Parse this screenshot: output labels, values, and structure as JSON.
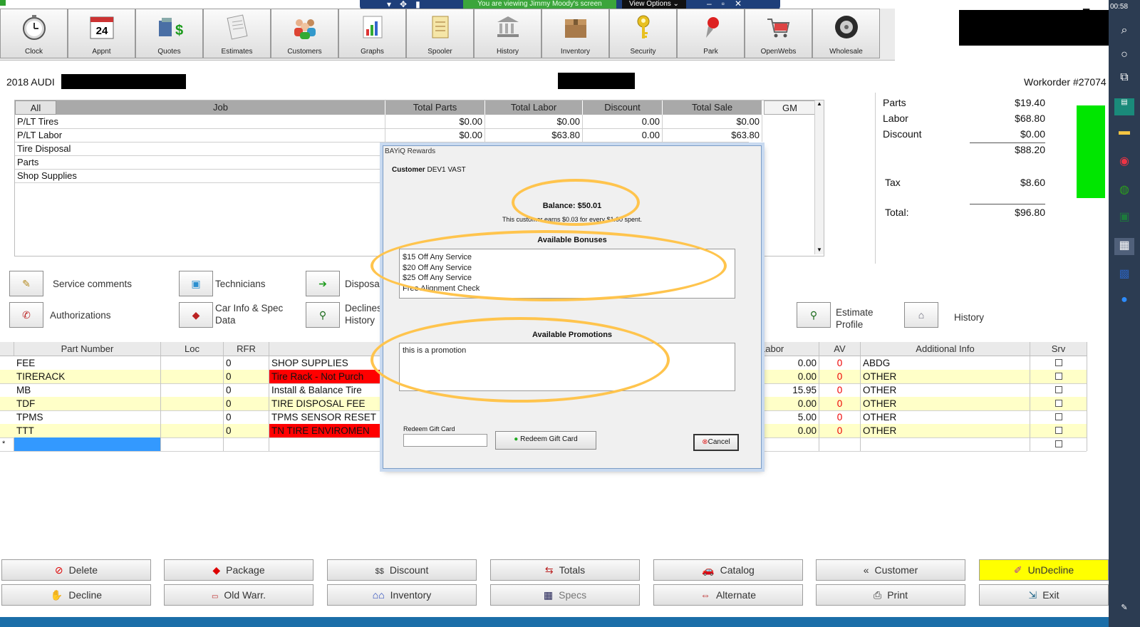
{
  "banner": {
    "viewing_text": "You are viewing Jimmy Moody's screen",
    "view_options": "View Options"
  },
  "clock_text": "00:58",
  "toolbar": {
    "buttons": [
      {
        "label": "Clock",
        "icon": "clock-icon"
      },
      {
        "label": "Appnt",
        "icon": "calendar-icon",
        "icon_text": "24"
      },
      {
        "label": "Quotes",
        "icon": "quotes-icon"
      },
      {
        "label": "Estimates",
        "icon": "estimates-icon"
      },
      {
        "label": "Customers",
        "icon": "customers-icon"
      },
      {
        "label": "Graphs",
        "icon": "graphs-icon"
      },
      {
        "label": "Spooler",
        "icon": "spooler-icon"
      },
      {
        "label": "History",
        "icon": "history-icon"
      },
      {
        "label": "Inventory",
        "icon": "inventory-box-icon"
      },
      {
        "label": "Security",
        "icon": "key-icon"
      },
      {
        "label": "Park",
        "icon": "pushpin-icon"
      },
      {
        "label": "OpenWebs",
        "icon": "cart-icon"
      },
      {
        "label": "Wholesale",
        "icon": "tire-icon"
      }
    ]
  },
  "vehicle": "2018 AUDI",
  "workorder": "Workorder #27074",
  "job_table": {
    "headers": [
      "All",
      "Job",
      "Total Parts",
      "Total Labor",
      "Discount",
      "Total Sale",
      "GM"
    ],
    "rows": [
      {
        "job": "P/LT Tires",
        "parts": "$0.00",
        "labor": "$0.00",
        "discount": "0.00",
        "sale": "$0.00"
      },
      {
        "job": "P/LT Labor",
        "parts": "$0.00",
        "labor": "$63.80",
        "discount": "0.00",
        "sale": "$63.80"
      },
      {
        "job": "Tire Disposal",
        "parts": "",
        "labor": "",
        "discount": "",
        "sale": ""
      },
      {
        "job": "Parts",
        "parts": "",
        "labor": "",
        "discount": "",
        "sale": ""
      },
      {
        "job": "Shop Supplies",
        "parts": "",
        "labor": "",
        "discount": "",
        "sale": ""
      }
    ]
  },
  "totals": {
    "parts_label": "Parts",
    "parts": "$19.40",
    "labor_label": "Labor",
    "labor": "$68.80",
    "discount_label": "Discount",
    "discount": "$0.00",
    "subtotal": "$88.20",
    "tax_label": "Tax",
    "tax": "$8.60",
    "total_label": "Total:",
    "total": "$96.80",
    "status_color": "#00e600"
  },
  "actions": {
    "service_comments": "Service comments",
    "technicians": "Technicians",
    "disposal": "Disposal",
    "authorizations": "Authorizations",
    "car_info": "Car Info & Spec Data",
    "declines": "Declines History",
    "estimate_profile": "Estimate Profile",
    "history": "History"
  },
  "parts_table": {
    "headers": [
      "Part Number",
      "Loc",
      "RFR",
      "Labor",
      "AV",
      "Additional Info",
      "Srv"
    ],
    "rows": [
      {
        "part": "FEE",
        "rfr": "0",
        "desc": "SHOP SUPPLIES",
        "labor": "0.00",
        "av": "0",
        "info": "ABDG"
      },
      {
        "part": "TIRERACK",
        "rfr": "0",
        "desc": "Tire Rack - Not Purch",
        "labor": "0.00",
        "av": "0",
        "info": "OTHER"
      },
      {
        "part": "MB",
        "rfr": "0",
        "desc": "Install & Balance Tire",
        "labor": "15.95",
        "av": "0",
        "info": "OTHER"
      },
      {
        "part": "TDF",
        "rfr": "0",
        "desc": "TIRE DISPOSAL FEE",
        "labor": "0.00",
        "av": "0",
        "info": "OTHER"
      },
      {
        "part": "TPMS",
        "rfr": "0",
        "desc": "TPMS SENSOR RESET",
        "labor": "5.00",
        "av": "0",
        "info": "OTHER"
      },
      {
        "part": "TTT",
        "rfr": "0",
        "desc": "TN TIRE ENVIROMEN",
        "labor": "0.00",
        "av": "0",
        "info": "OTHER"
      }
    ],
    "new_row_marker": "*"
  },
  "bottom_buttons": {
    "delete": "Delete",
    "package": "Package",
    "discount": "Discount",
    "totals": "Totals",
    "catalog": "Catalog",
    "customer": "Customer",
    "undecline": "UnDecline",
    "decline": "Decline",
    "old_warr": "Old Warr.",
    "inventory": "Inventory",
    "specs": "Specs",
    "alternate": "Alternate",
    "print": "Print",
    "exit": "Exit",
    "highlight_color": "#ffff00"
  },
  "dialog": {
    "title": "BAYiQ Rewards",
    "customer_label": "Customer",
    "customer_name": "DEV1 VAST",
    "balance": "Balance: $50.01",
    "earn_text": "This customer earns $0.03 for every $1.00 spent.",
    "bonuses_header": "Available Bonuses",
    "bonuses": [
      "$15 Off Any Service",
      "$20 Off Any Service",
      "$25 Off Any Service",
      "Free Alignment Check"
    ],
    "promotions_header": "Available Promotions",
    "promotion": "this is a promotion",
    "gift_card_label": "Redeem Gift Card",
    "redeem_button": "Redeem Gift Card",
    "cancel_button": "Cancel",
    "highlight_color": "#ffc44d"
  }
}
